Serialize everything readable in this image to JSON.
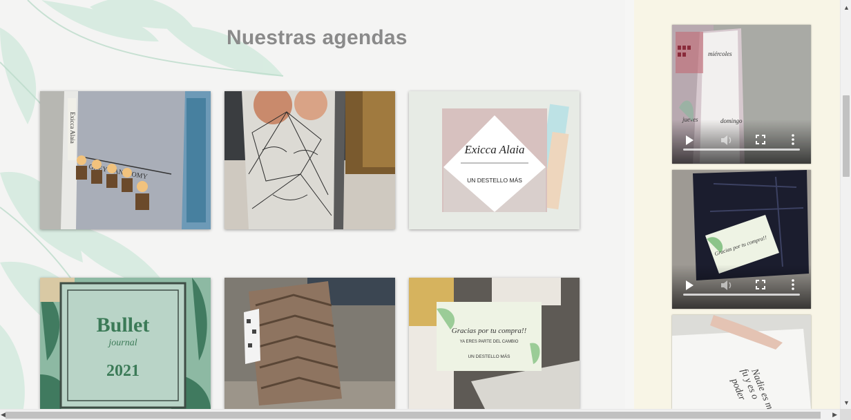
{
  "section": {
    "title": "Nuestras agendas"
  },
  "gallery": {
    "tiles": [
      {
        "name": "agenda-greys-anatomy",
        "cover_text": "GREY'S ANATOMY",
        "brand": "Exicca Alaia"
      },
      {
        "name": "agenda-face-sketch"
      },
      {
        "name": "agenda-brand-logo",
        "logo_script": "Exicca Alaia",
        "logo_tagline": "UN DESTELLO MÁS"
      },
      {
        "name": "agenda-bullet-journal",
        "cover_line1": "Bullet",
        "cover_line2": "journal",
        "cover_year": "2021"
      },
      {
        "name": "agenda-chevron-wood"
      },
      {
        "name": "agenda-thank-you-card",
        "card_text": "Gracias por tu compra!!",
        "card_sub": "YA ERES PARTE DEL CAMBIO",
        "card_brand": "UN DESTELLO MÁS"
      }
    ]
  },
  "sidebar": {
    "videos": [
      {
        "name": "video-planner-pages",
        "page_labels": [
          "miércoles",
          "jueves",
          "domingo"
        ]
      },
      {
        "name": "video-thank-you-card",
        "card_text": "Gracias por tu compra!!"
      },
      {
        "name": "video-notebook-page",
        "page_text": [
          "Nadie es mi",
          "fu y es o",
          "poder"
        ]
      }
    ]
  },
  "icons": {
    "play": "play-icon",
    "volume": "volume-icon",
    "fullscreen": "fullscreen-icon",
    "more": "more-vertical-icon",
    "scroll_up": "scroll-up-icon",
    "scroll_down": "scroll-down-icon",
    "scroll_left": "scroll-left-icon",
    "scroll_right": "scroll-right-icon"
  },
  "colors": {
    "title": "#8a8a8a",
    "sidebar_bg": "#f8f5e6",
    "page_bg": "#f4f4f3",
    "leaf": "#bfe3d0"
  }
}
